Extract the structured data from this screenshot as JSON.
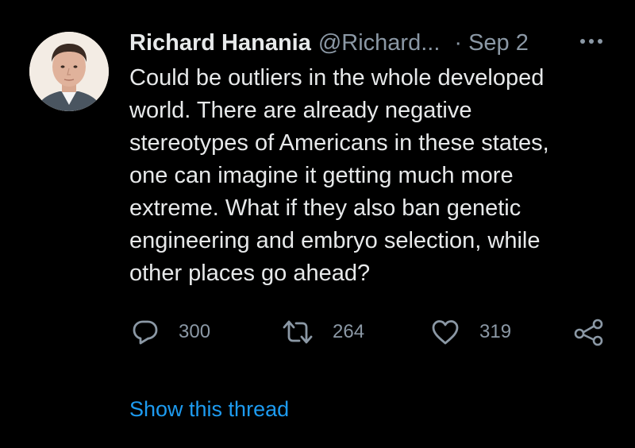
{
  "author": {
    "display_name": "Richard Hanania",
    "handle": "@Richard...",
    "separator": "·",
    "time": "Sep 2"
  },
  "tweet": {
    "lines": [
      "Could be outliers in the whole developed",
      "world. There are already negative",
      "stereotypes of Americans in these states,",
      "one can imagine it getting much more",
      "extreme. What if they also ban genetic",
      "engineering and embryo selection, while",
      "other places go ahead?"
    ]
  },
  "actions": {
    "reply_count": "300",
    "retweet_count": "264",
    "like_count": "319"
  },
  "thread": {
    "show_label": "Show this thread"
  },
  "icons": {
    "more": "more-dots-icon",
    "reply": "reply-bubble-icon",
    "retweet": "retweet-icon",
    "like": "heart-icon",
    "share": "share-icon"
  },
  "colors": {
    "background": "#000000",
    "text": "#e7e9ea",
    "secondary": "#8b98a5",
    "link": "#1d9bf0"
  }
}
